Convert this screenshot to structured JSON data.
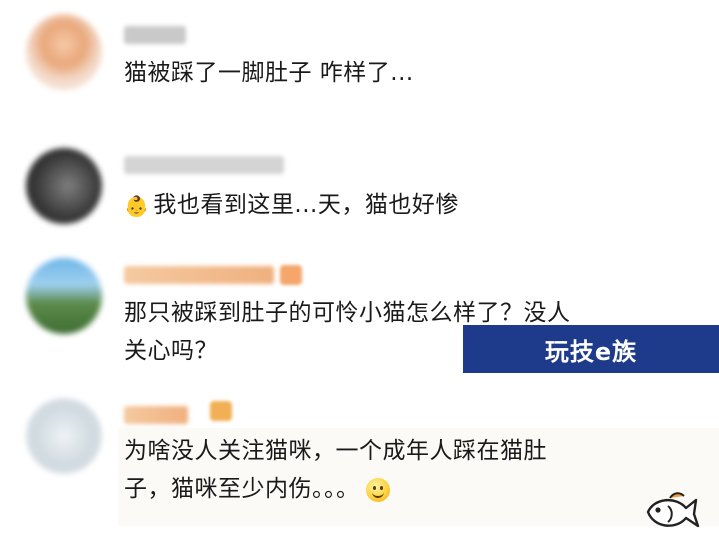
{
  "comments": [
    {
      "text": "猫被踩了一脚肚子 咋样了..."
    },
    {
      "emoji": "👶",
      "text": "我也看到这里...天，猫也好惨"
    },
    {
      "line1": "那只被踩到肚子的可怜小猫怎么样了？没人",
      "line2": "关心吗？"
    },
    {
      "line1": "为啥没人关注猫咪，一个成年人踩在猫肚",
      "line2": "子，猫咪至少内伤。。。"
    }
  ],
  "watermark": {
    "text": "玩技e族"
  },
  "icons": {
    "smiley": "smiley-emoji-icon",
    "fish": "fish-logo-icon"
  }
}
